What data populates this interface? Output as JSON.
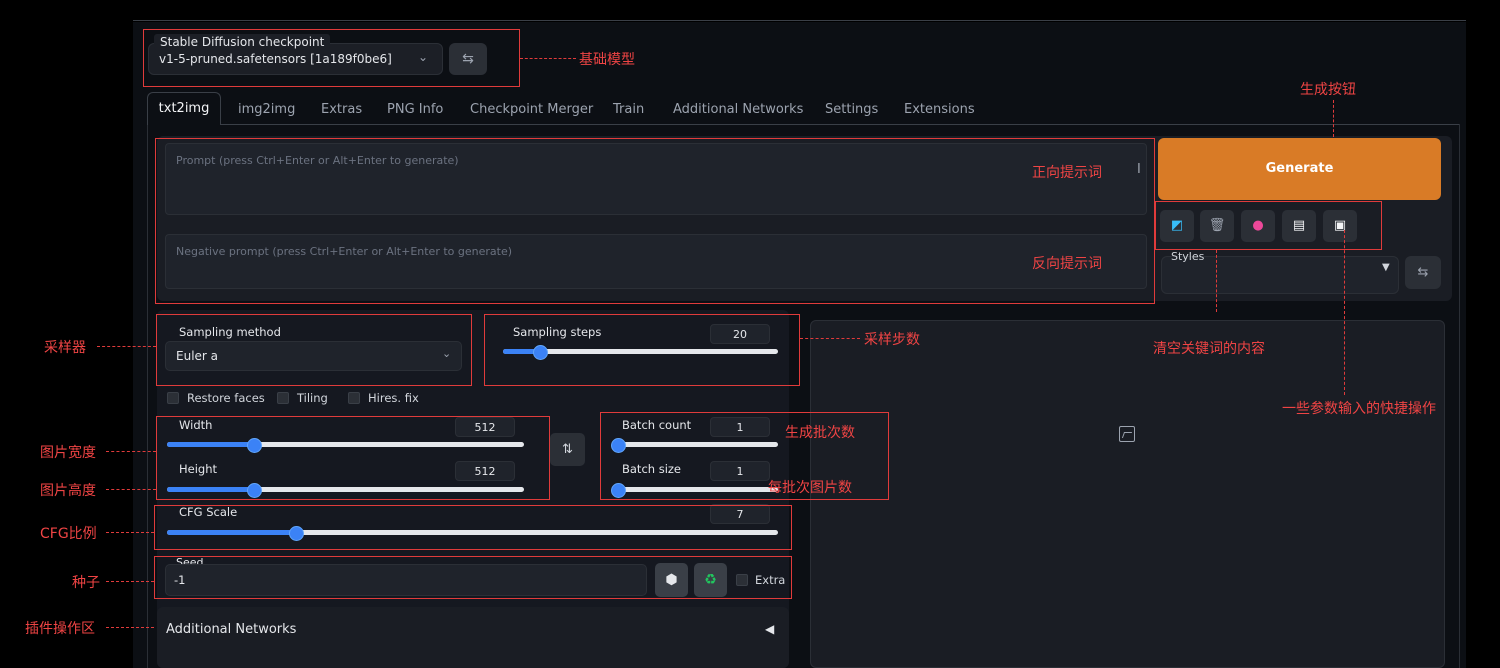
{
  "checkpoint": {
    "label": "Stable Diffusion checkpoint",
    "value": "v1-5-pruned.safetensors [1a189f0be6]"
  },
  "tabs": [
    "txt2img",
    "img2img",
    "Extras",
    "PNG Info",
    "Checkpoint Merger",
    "Train",
    "Additional Networks",
    "Settings",
    "Extensions"
  ],
  "prompt": {
    "placeholder": "Prompt (press Ctrl+Enter or Alt+Enter to generate)"
  },
  "negative_prompt": {
    "placeholder": "Negative prompt (press Ctrl+Enter or Alt+Enter to generate)"
  },
  "generate_label": "Generate",
  "styles_label": "Styles",
  "sampling": {
    "method_label": "Sampling method",
    "method_value": "Euler a",
    "steps_label": "Sampling steps",
    "steps_value": "20",
    "steps_fraction": 0.13
  },
  "checkboxes": [
    "Restore faces",
    "Tiling",
    "Hires. fix"
  ],
  "width": {
    "label": "Width",
    "value": "512",
    "fraction": 0.24
  },
  "height": {
    "label": "Height",
    "value": "512",
    "fraction": 0.24
  },
  "batch_count": {
    "label": "Batch count",
    "value": "1",
    "fraction": 0.0
  },
  "batch_size": {
    "label": "Batch size",
    "value": "1",
    "fraction": 0.0
  },
  "cfg": {
    "label": "CFG Scale",
    "value": "7",
    "fraction": 0.21
  },
  "seed": {
    "label": "Seed",
    "value": "-1",
    "extra_label": "Extra"
  },
  "additional_networks_label": "Additional Networks",
  "colors": {
    "generate": "#d97b26",
    "slider": "#3b82f6",
    "annotation": "#e03b3b"
  },
  "annotations": {
    "base_model": "基础模型",
    "generate_button": "生成按钮",
    "positive_prompt": "正向提示词",
    "negative_prompt": "反向提示词",
    "sampler": "采样器",
    "sampling_steps": "采样步数",
    "clear_content": "清空关键词的内容",
    "shortcuts": "一些参数输入的快捷操作",
    "image_width": "图片宽度",
    "image_height": "图片高度",
    "batch_count": "生成批次数",
    "batch_size": "每批次图片数",
    "cfg": "CFG比例",
    "seed": "种子",
    "plugins": "插件操作区"
  }
}
